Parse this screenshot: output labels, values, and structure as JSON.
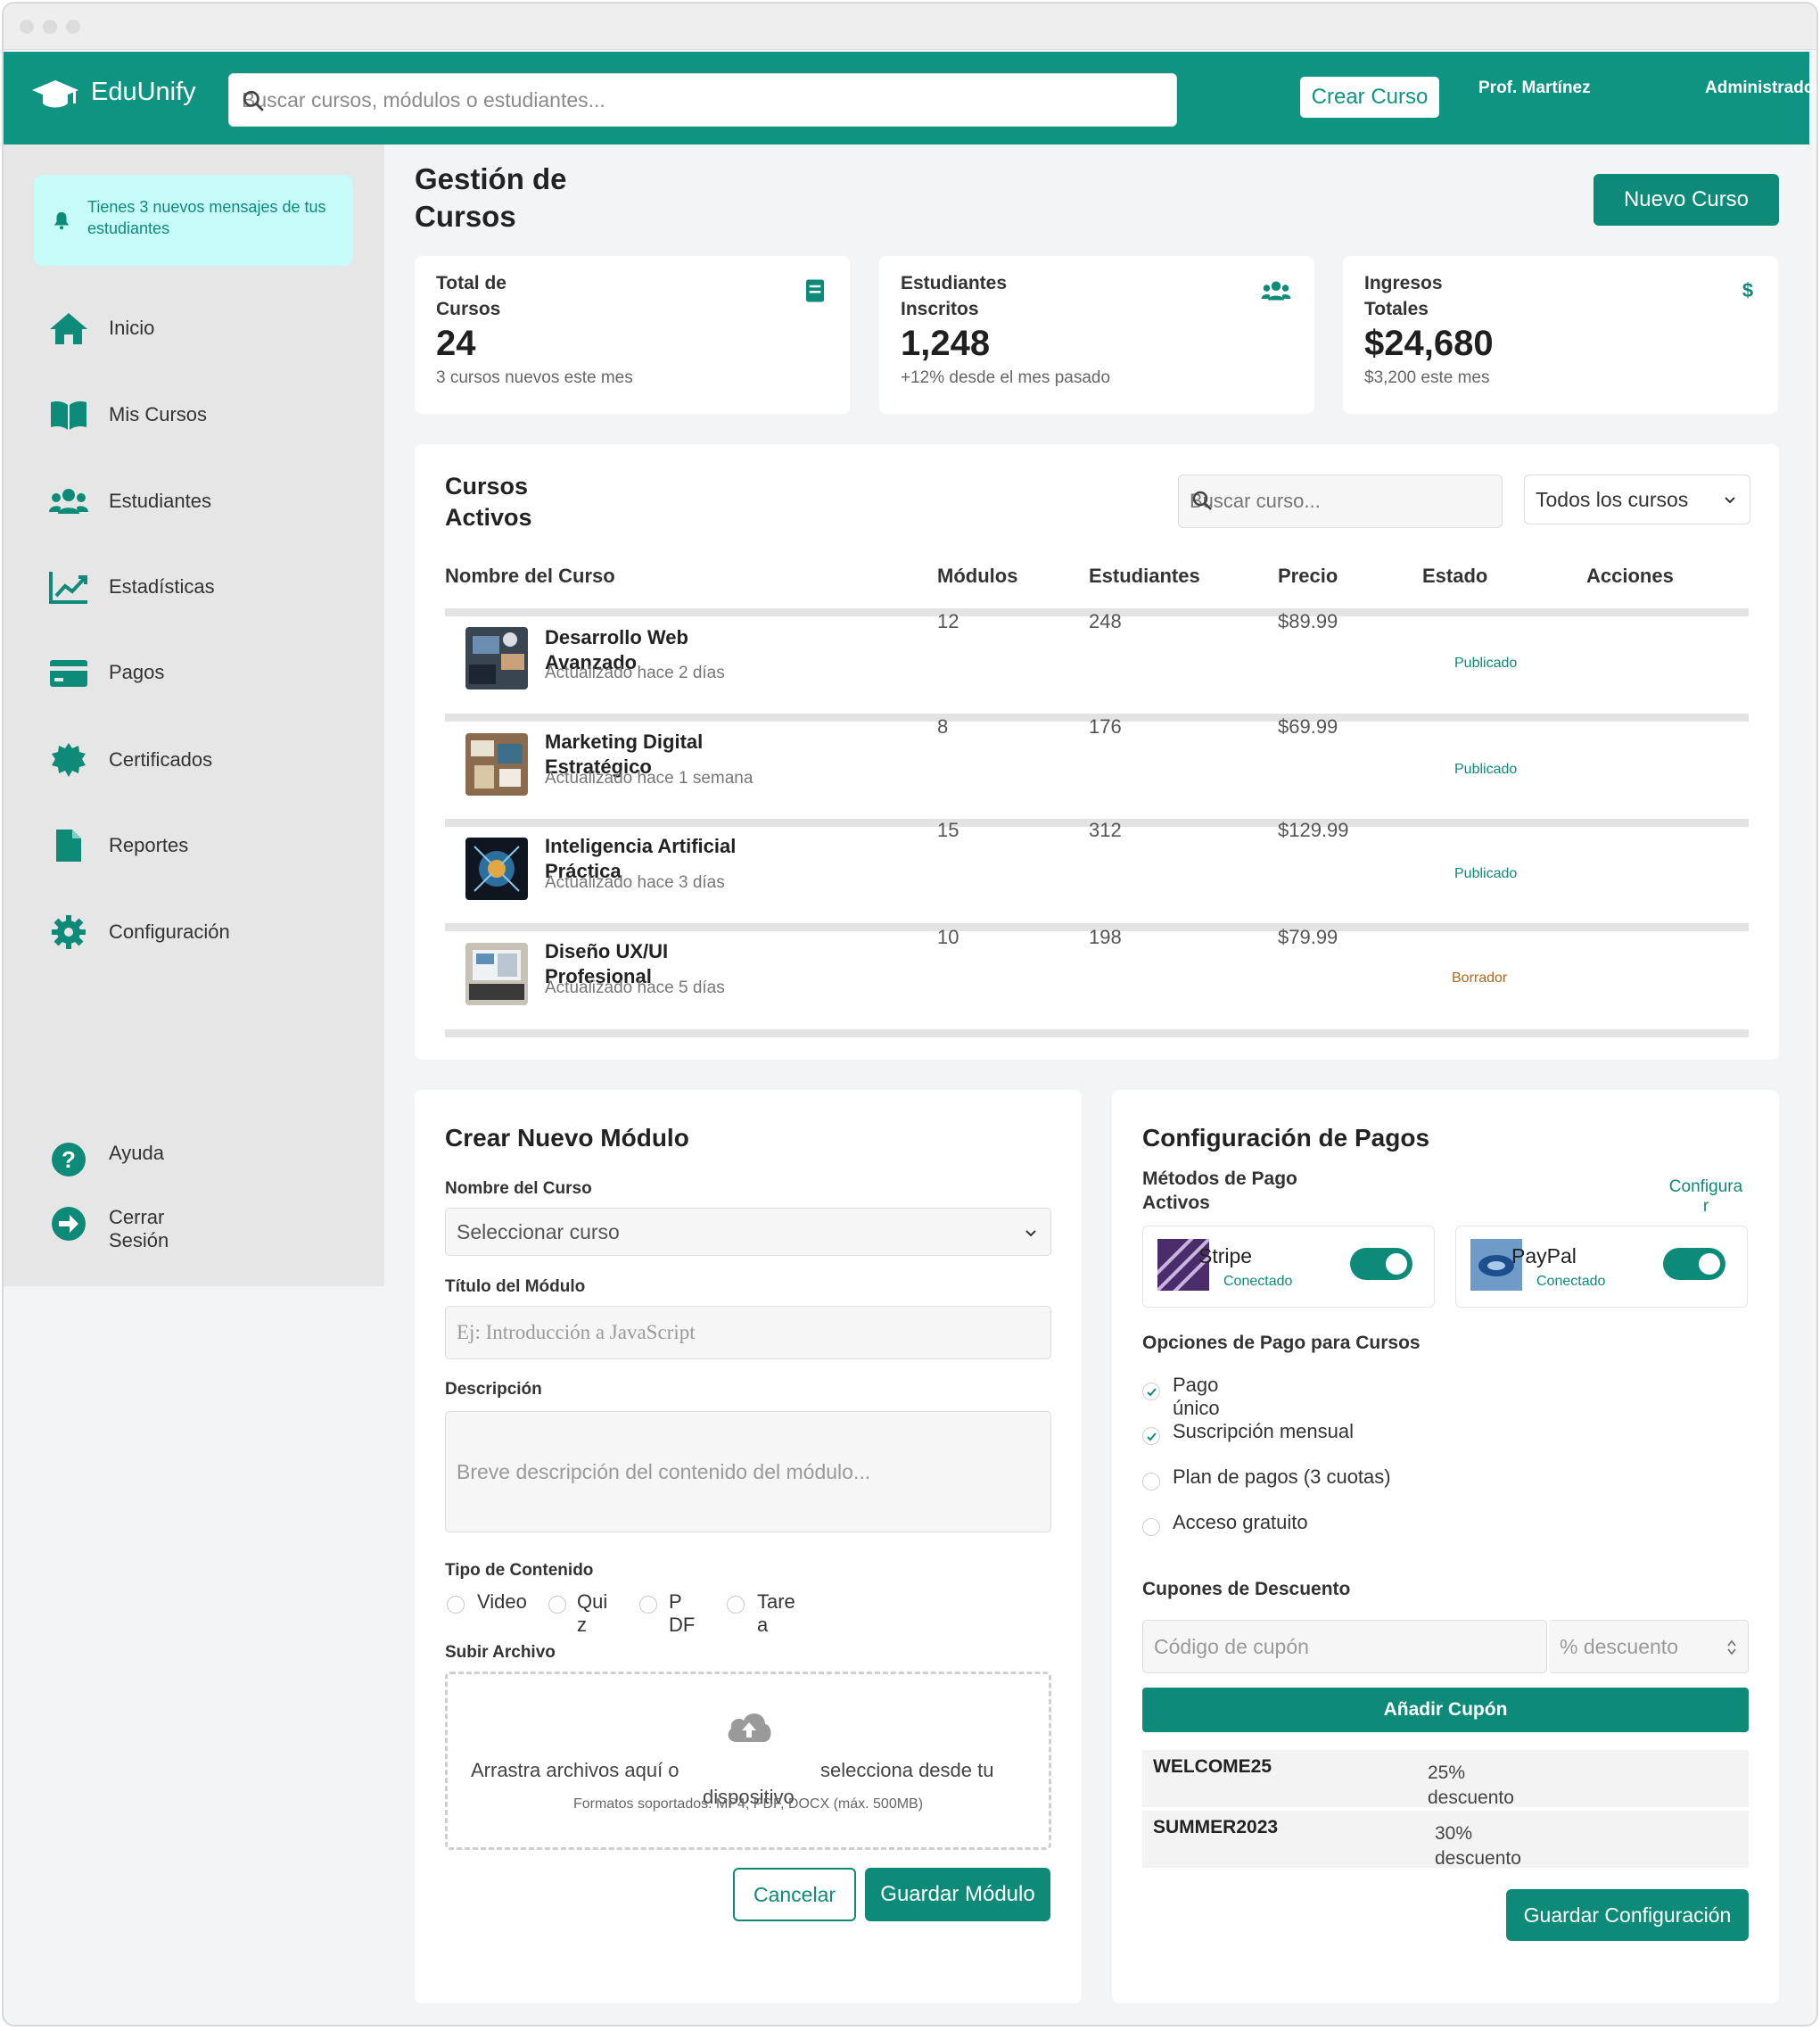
{
  "header": {
    "logo_text": "EduUnify",
    "search_placeholder": "Buscar cursos, módulos o estudiantes...",
    "create_course_label": "Crear Curso",
    "user_name": "Prof. Martínez",
    "user_role": "Administrador"
  },
  "sidebar": {
    "notification": "Tienes 3 nuevos mensajes de tus estudiantes",
    "items": [
      {
        "label": "Inicio",
        "icon": "home-icon"
      },
      {
        "label": "Mis Cursos",
        "icon": "book-icon"
      },
      {
        "label": "Estudiantes",
        "icon": "users-icon"
      },
      {
        "label": "Estadísticas",
        "icon": "chart-icon"
      },
      {
        "label": "Pagos",
        "icon": "credit-card-icon"
      },
      {
        "label": "Certificados",
        "icon": "certificate-icon"
      },
      {
        "label": "Reportes",
        "icon": "file-icon"
      },
      {
        "label": "Configuración",
        "icon": "gear-icon"
      }
    ],
    "help_label": "Ayuda",
    "logout_label": "Cerrar Sesión"
  },
  "main": {
    "title": "Gestión de Cursos",
    "new_course_label": "Nuevo Curso",
    "stats": [
      {
        "label": "Total de Cursos",
        "value": "24",
        "sub": "3 cursos nuevos este mes",
        "icon": "book-icon"
      },
      {
        "label": "Estudiantes Inscritos",
        "value": "1,248",
        "sub": "+12% desde el mes pasado",
        "icon": "users-icon"
      },
      {
        "label": "Ingresos Totales",
        "value": "$24,680",
        "sub": "$3,200 este mes",
        "icon": "dollar-icon"
      }
    ]
  },
  "courses": {
    "title": "Cursos Activos",
    "search_placeholder": "Buscar curso...",
    "filter_value": "Todos los cursos",
    "columns": [
      "Nombre del Curso",
      "Módulos",
      "Estudiantes",
      "Precio",
      "Estado",
      "Acciones"
    ],
    "rows": [
      {
        "name": "Desarrollo Web Avanzado",
        "updated": "Actualizado hace 2 días",
        "modules": "12",
        "students": "248",
        "price": "$89.99",
        "status": "Publicado"
      },
      {
        "name": "Marketing Digital Estratégico",
        "updated": "Actualizado hace 1 semana",
        "modules": "8",
        "students": "176",
        "price": "$69.99",
        "status": "Publicado"
      },
      {
        "name": "Inteligencia Artificial Práctica",
        "updated": "Actualizado hace 3 días",
        "modules": "15",
        "students": "312",
        "price": "$129.99",
        "status": "Publicado"
      },
      {
        "name": "Diseño UX/UI Profesional",
        "updated": "Actualizado hace 5 días",
        "modules": "10",
        "students": "198",
        "price": "$79.99",
        "status": "Borrador"
      }
    ]
  },
  "module_form": {
    "title": "Crear Nuevo Módulo",
    "course_label": "Nombre del Curso",
    "course_value": "Seleccionar curso",
    "module_title_label": "Título del Módulo",
    "module_title_placeholder": "Ej: Introducción a JavaScript",
    "description_label": "Descripción",
    "description_placeholder": "Breve descripción del contenido del módulo...",
    "content_type_label": "Tipo de Contenido",
    "content_types": [
      "Video",
      "Quiz",
      "PDF",
      "Tarea"
    ],
    "upload_label": "Subir Archivo",
    "upload_text_a": "Arrastra archivos aquí o",
    "upload_text_b": "selecciona desde tu",
    "upload_text_c": "dispositivo",
    "upload_formats": "Formatos soportados: MP4, PDF, DOCX (máx. 500MB)",
    "cancel_label": "Cancelar",
    "save_label": "Guardar Módulo"
  },
  "payments": {
    "title": "Configuración de Pagos",
    "methods_label": "Métodos de Pago Activos",
    "configure_label": "Configurar",
    "methods": [
      {
        "name": "Stripe",
        "status": "Conectado"
      },
      {
        "name": "PayPal",
        "status": "Conectado"
      }
    ],
    "options_label": "Opciones de Pago para Cursos",
    "options": [
      {
        "label": "Pago único",
        "checked": true
      },
      {
        "label": "Suscripción mensual",
        "checked": true
      },
      {
        "label": "Plan de pagos (3 cuotas)",
        "checked": false
      },
      {
        "label": "Acceso gratuito",
        "checked": false
      }
    ],
    "coupons_label": "Cupones de Descuento",
    "coupon_code_placeholder": "Código de cupón",
    "coupon_discount_placeholder": "% descuento",
    "add_coupon_label": "Añadir Cupón",
    "coupons": [
      {
        "code": "WELCOME25",
        "discount": "25% descuento"
      },
      {
        "code": "SUMMER2023",
        "discount": "30% descuento"
      }
    ],
    "save_label": "Guardar Configuración"
  },
  "colors": {
    "primary": "#0e9481",
    "primary_dark": "#0e8a78",
    "notification_bg": "#c6fbf7",
    "draft": "#b5651d"
  }
}
